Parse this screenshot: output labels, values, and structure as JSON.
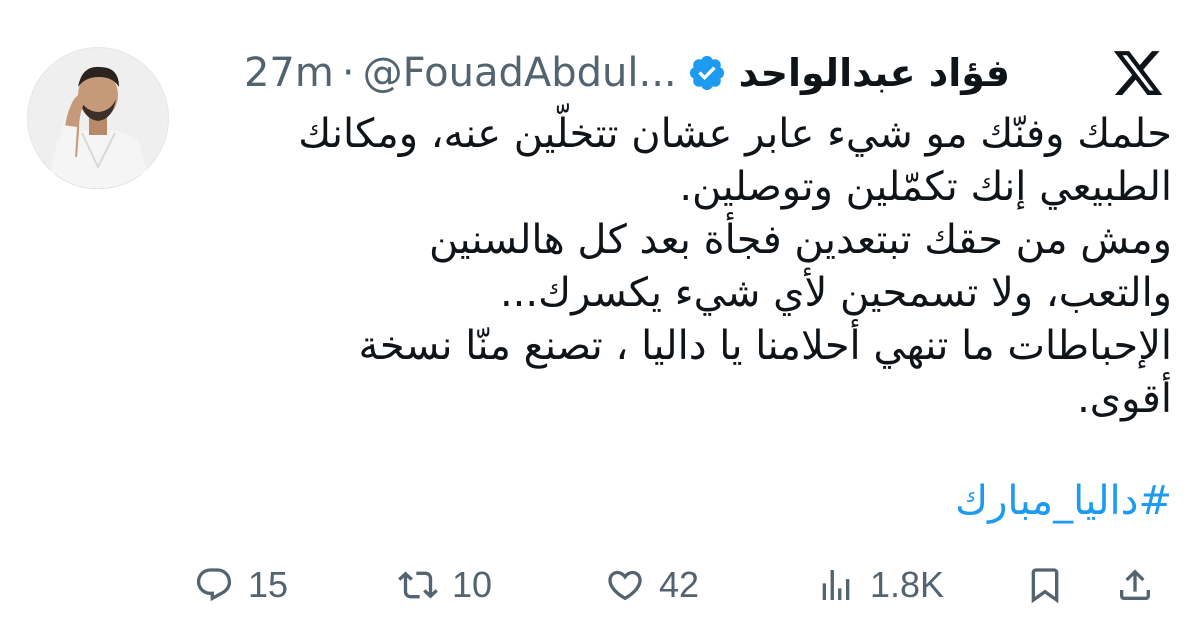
{
  "tweet": {
    "author_name": "فؤاد عبدالواحد",
    "handle": "@FouadAbdul...",
    "separator": "·",
    "time": "27m",
    "lines": [
      "حلمك وفنّك مو شيء عابر عشان تتخلّين عنه،  ومكانك",
      "الطبيعي إنك تكمّلين وتوصلين.",
      "ومش من حقك تبتعدين فجأة بعد كل هالسنين",
      "والتعب، ولا تسمحين لأي شيء يكسرك...",
      "الإحباطات ما تنهي أحلامنا يا داليا ، تصنع منّا نسخة",
      "أقوى."
    ],
    "hashtag": "#داليا_مبارك"
  },
  "actions": {
    "replies": "15",
    "retweets": "10",
    "likes": "42",
    "views": "1.8K"
  },
  "icons": {
    "logo": "x-logo-icon",
    "verified": "verified-badge-icon",
    "reply": "reply-icon",
    "retweet": "retweet-icon",
    "like": "heart-icon",
    "views": "views-chart-icon",
    "bookmark": "bookmark-icon",
    "share": "share-icon"
  },
  "colors": {
    "text": "#0f1419",
    "muted": "#536471",
    "accent": "#1d9bf0"
  }
}
